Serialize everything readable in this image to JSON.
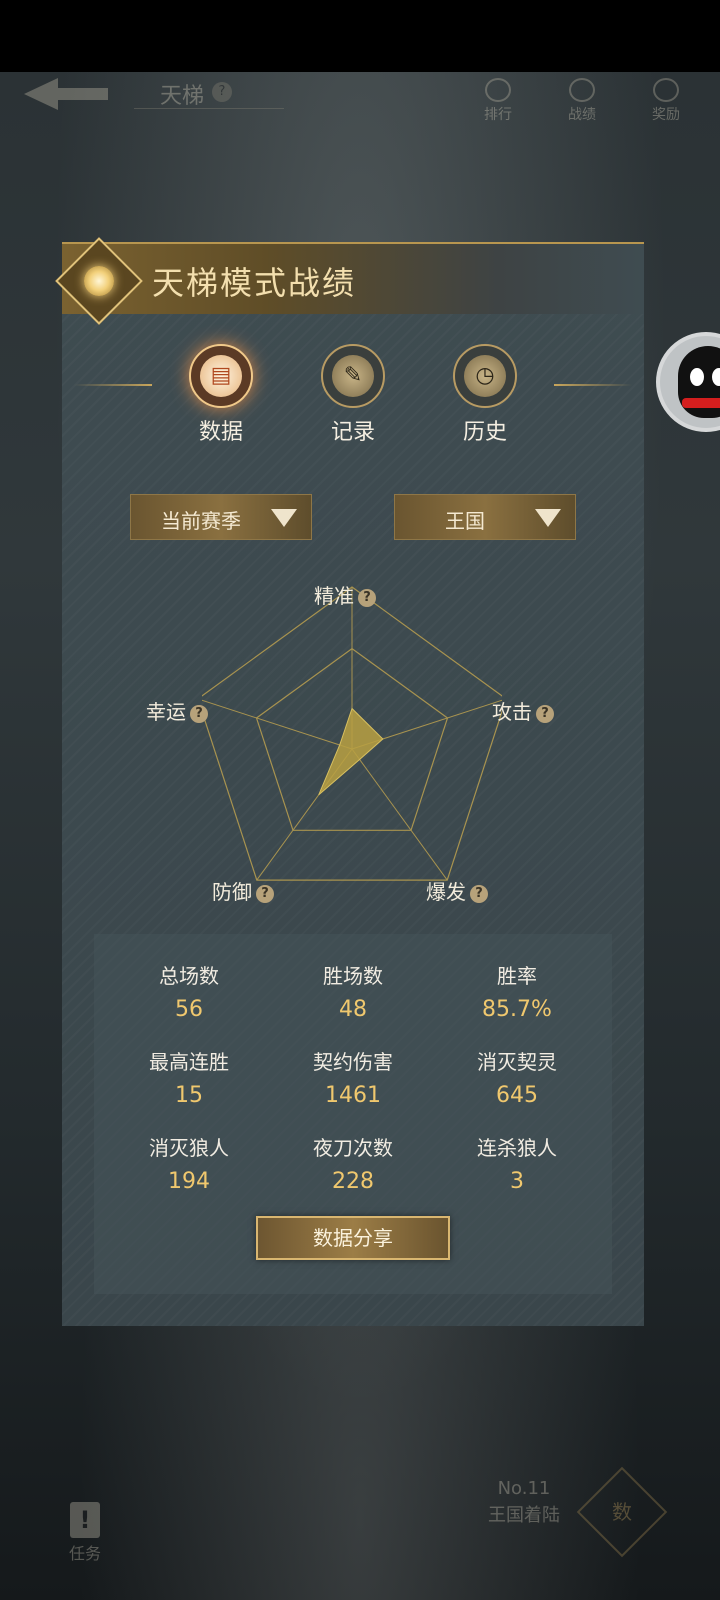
{
  "top_nav": {
    "title": "天梯",
    "help": "?",
    "items": [
      {
        "label": "排行"
      },
      {
        "label": "战绩"
      },
      {
        "label": "奖励"
      }
    ]
  },
  "panel": {
    "title": "天梯模式战绩",
    "tabs": [
      {
        "label": "数据",
        "icon": "chart-icon",
        "active": true
      },
      {
        "label": "记录",
        "icon": "quill-icon",
        "active": false
      },
      {
        "label": "历史",
        "icon": "history-icon",
        "active": false
      }
    ],
    "season_dropdown": "当前赛季",
    "mode_dropdown": "王国",
    "radar": {
      "axes": [
        "精准",
        "攻击",
        "爆发",
        "防御",
        "幸运"
      ],
      "values": [
        0.25,
        0.2,
        0.08,
        0.35,
        0.08
      ],
      "help": "?"
    },
    "stats": [
      {
        "label": "总场数",
        "value": "56"
      },
      {
        "label": "胜场数",
        "value": "48"
      },
      {
        "label": "胜率",
        "value": "85.7%"
      },
      {
        "label": "最高连胜",
        "value": "15"
      },
      {
        "label": "契约伤害",
        "value": "1461"
      },
      {
        "label": "消灭契灵",
        "value": "645"
      },
      {
        "label": "消灭狼人",
        "value": "194"
      },
      {
        "label": "夜刀次数",
        "value": "228"
      },
      {
        "label": "连杀狼人",
        "value": "3"
      }
    ],
    "share_button": "数据分享"
  },
  "bottom": {
    "task_label": "任务",
    "rank_no": "No.11",
    "rank_title": "王国着陆",
    "emblem_text": "数"
  },
  "colors": {
    "accent_gold": "#f0c86e",
    "radar_fill": "#b8a042",
    "panel_bg": "#3f4c51"
  }
}
